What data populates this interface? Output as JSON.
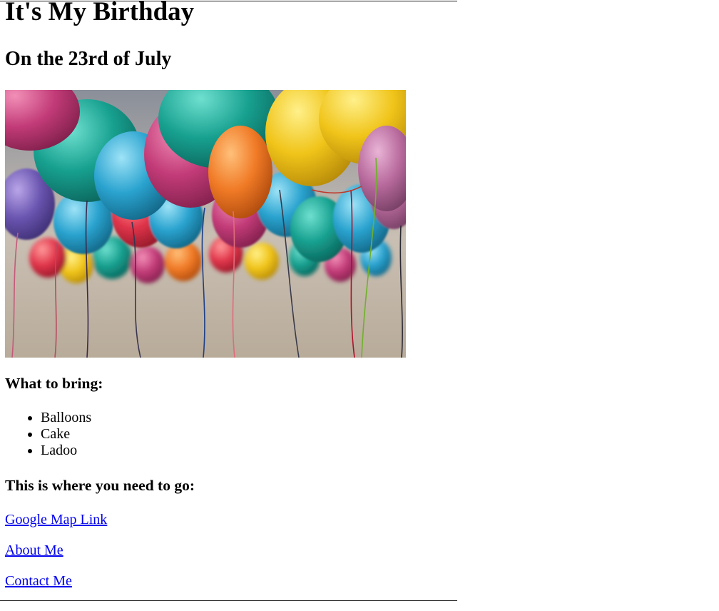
{
  "page": {
    "title": "It's My Birthday",
    "subtitle": "On the 23rd of July"
  },
  "image": {
    "description_icon": "balloons-photo",
    "alt": ""
  },
  "bring": {
    "heading": "What to bring:",
    "items": [
      "Balloons",
      "Cake",
      "Ladoo"
    ]
  },
  "location": {
    "heading": "This is where you need to go:"
  },
  "links": {
    "map": "Google Map Link",
    "about": "About Me",
    "contact": "Contact Me"
  },
  "colors": {
    "link": "#0000ee",
    "text": "#000000",
    "background": "#ffffff"
  }
}
